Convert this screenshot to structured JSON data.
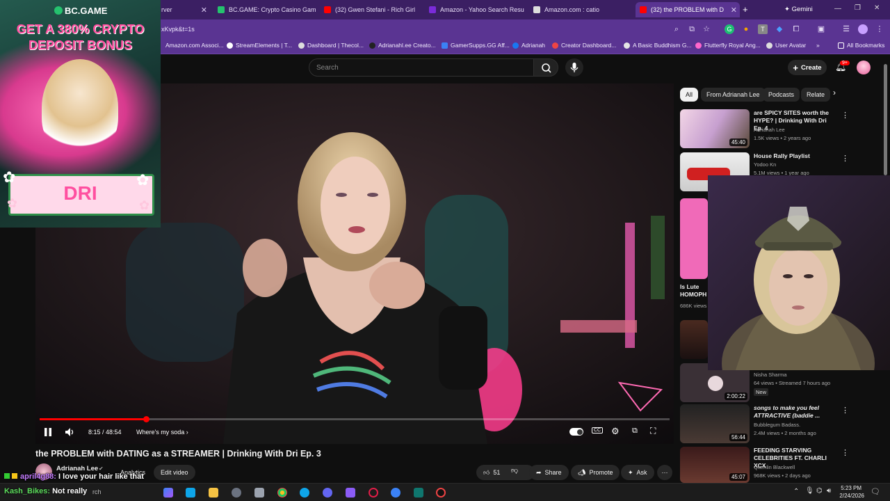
{
  "tabs": [
    {
      "label": "rver",
      "active": false
    },
    {
      "label": "BC.GAME: Crypto Casino Gam",
      "active": false
    },
    {
      "label": "(32) Gwen Stefani - Rich Girl",
      "active": false
    },
    {
      "label": "Amazon - Yahoo Search Resu",
      "active": false
    },
    {
      "label": "Amazon.com : catio",
      "active": false
    },
    {
      "label": "(32) the PROBLEM with D",
      "active": true
    }
  ],
  "gemini_label": "Gemini",
  "url": "xKvpk&t=1s",
  "bookmarks": [
    "Amazon.com Associ...",
    "StreamElements | T...",
    "Dashboard | Thecol...",
    "Adrianahl.ee Creato...",
    "GamerSupps.GG Aff...",
    "Adrianah",
    "Creator Dashboard...",
    "A Basic Buddhism G...",
    "Flutterfly Royal Ang...",
    "User Avatar"
  ],
  "all_bookmarks": "All Bookmarks",
  "ad": {
    "brand": "BC.GAME",
    "headline_1": "GET A 380% CRYPTO",
    "headline_2": "DEPOSIT BONUS",
    "code": "DRI"
  },
  "youtube": {
    "search_placeholder": "Search",
    "create_label": "Create",
    "notification_count": "9+"
  },
  "player": {
    "time": "8:15 / 48:54",
    "progress": 0.169,
    "chapter": "Where's my soda"
  },
  "video": {
    "title": "the PROBLEM with DATING as a STREAMER | Drinking With Dri Ep. 3",
    "channel": "Adrianah Lee",
    "analytics_label": "Analytics",
    "edit_label": "Edit video",
    "likes": "51",
    "share_label": "Share",
    "promote_label": "Promote",
    "ask_label": "Ask"
  },
  "chips": [
    "All",
    "From Adrianah Lee",
    "Podcasts",
    "Relate"
  ],
  "recommendations": [
    {
      "title": "are SPICY SITES worth the HYPE? | Drinking With Dri Ep. 4",
      "channel": "Adrianah Lee",
      "meta": "1.5K views • 2 years ago",
      "duration": "45:40"
    },
    {
      "title": "House Rally Playlist",
      "channel": "Yodoo Kn",
      "meta": "5.1M views • 1 year ago",
      "duration": ""
    },
    {
      "title": "Is Lute HOMOPH",
      "channel": "",
      "meta": "686K views",
      "duration": ""
    },
    {
      "title": "",
      "channel": "Nisha Sharma",
      "meta": "64 views • Streamed 7 hours ago",
      "badge": "New",
      "duration": "2:00:22"
    },
    {
      "title": "songs to make you feel ATTRACTIVE (baddie ...",
      "channel": "Bubblegum Badass.",
      "meta": "2.4M views • 2 months ago",
      "duration": "56:44"
    },
    {
      "title": "FEEDING STARVING CELEBRITIES FT. CHARLI XCX",
      "channel": "Quenlin Blackwell",
      "meta": "968K views • 2 days ago",
      "duration": "45:07"
    }
  ],
  "chat": [
    {
      "user": "april4g88:",
      "message": "I love your hair like that"
    },
    {
      "user": "Kash_Bikes:",
      "message": "Not really"
    }
  ],
  "taskbar": {
    "search_fragment": "rch",
    "time": "5:23 PM",
    "date": "2/24/2026"
  },
  "colors": {
    "accent": "#ff0000",
    "chrome": "#5a3492",
    "ad_pink": "#ff4fa0"
  }
}
